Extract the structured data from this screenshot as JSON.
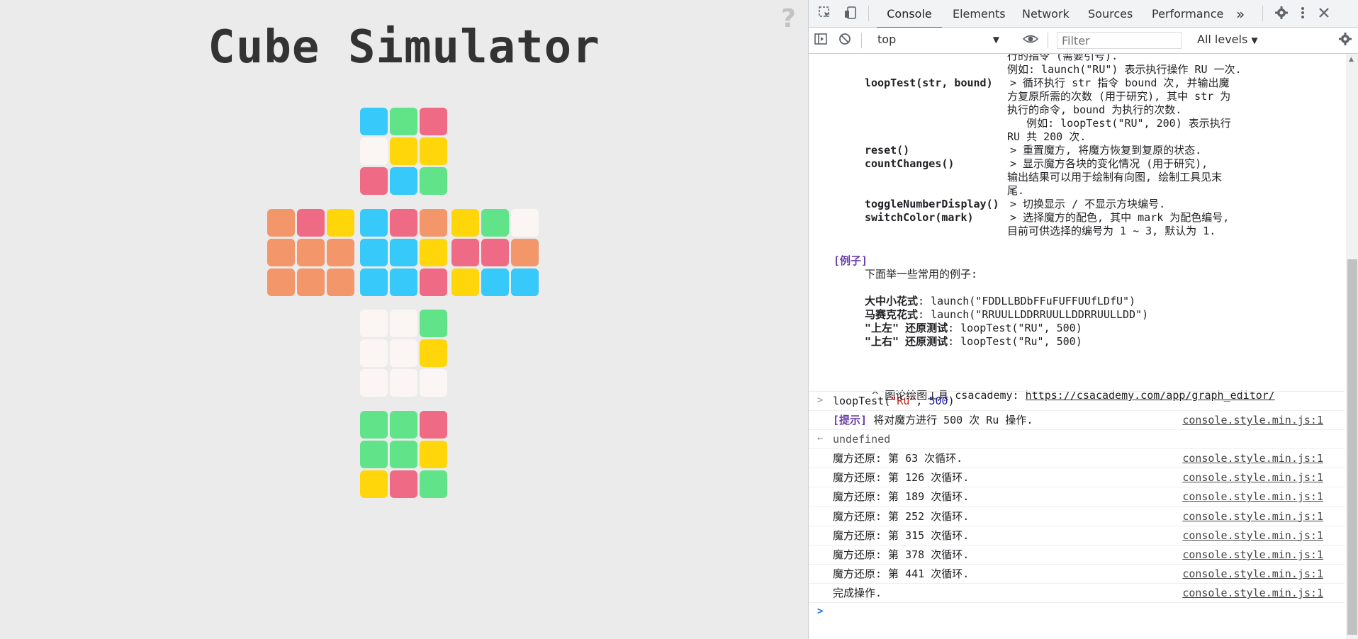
{
  "page": {
    "title": "Cube Simulator",
    "help_icon": "?"
  },
  "cube": {
    "colors": {
      "W": "#fbf6f4",
      "Y": "#ffd60a",
      "G": "#61e38a",
      "B": "#36c9f9",
      "R": "#ee6a85",
      "O": "#f3966a"
    },
    "faces": {
      "up": [
        "B",
        "G",
        "R",
        "W",
        "Y",
        "Y",
        "R",
        "B",
        "G"
      ],
      "left": [
        "O",
        "R",
        "Y",
        "O",
        "O",
        "O",
        "O",
        "O",
        "O"
      ],
      "front": [
        "B",
        "R",
        "O",
        "B",
        "B",
        "Y",
        "B",
        "B",
        "R"
      ],
      "right": [
        "Y",
        "G",
        "W",
        "R",
        "R",
        "O",
        "Y",
        "B",
        "B"
      ],
      "down": [
        "W",
        "W",
        "G",
        "W",
        "W",
        "Y",
        "W",
        "W",
        "W"
      ],
      "back": [
        "G",
        "G",
        "R",
        "G",
        "G",
        "Y",
        "Y",
        "R",
        "G"
      ]
    }
  },
  "devtools": {
    "tabs": [
      "Console",
      "Elements",
      "Network",
      "Sources",
      "Performance"
    ],
    "more_tabs": "»",
    "context": "top",
    "filter_placeholder": "Filter",
    "levels": "All levels",
    "help_lines": [
      {
        "cmd": "",
        "desc": "行的指令 (需要引号)."
      },
      {
        "cmd": "",
        "desc": "例如: launch(\"RU\") 表示执行操作 RU 一次."
      },
      {
        "cmd": "loopTest(str, bound)",
        "desc": "> 循环执行 str 指令 bound 次, 并输出魔"
      },
      {
        "cmd": "",
        "desc": "方复原所需的次数 (用于研究), 其中 str 为"
      },
      {
        "cmd": "",
        "desc": "执行的命令, bound 为执行的次数."
      },
      {
        "cmd": "",
        "desc": "   例如: loopTest(\"RU\", 200) 表示执行"
      },
      {
        "cmd": "",
        "desc": "RU 共 200 次."
      },
      {
        "cmd": "reset()",
        "desc": "> 重置魔方, 将魔方恢复到复原的状态."
      },
      {
        "cmd": "countChanges()",
        "desc": "> 显示魔方各块的变化情况 (用于研究),"
      },
      {
        "cmd": "",
        "desc": "输出结果可以用于绘制有向图, 绘制工具见末"
      },
      {
        "cmd": "",
        "desc": "尾."
      },
      {
        "cmd": "toggleNumberDisplay()",
        "desc": "> 切换显示 / 不显示方块编号."
      },
      {
        "cmd": "switchColor(mark)",
        "desc": "> 选择魔方的配色, 其中 mark 为配色编号,"
      },
      {
        "cmd": "",
        "desc": "目前可供选择的编号为 1 ~ 3, 默认为 1."
      }
    ],
    "examples_heading": "[例子]",
    "examples_intro": "下面举一些常用的例子:",
    "examples": [
      {
        "name": "大中小花式",
        "code": ": launch(\"FDDLLBDbFFuFUFFUUfLDfU\")"
      },
      {
        "name": "马赛克花式",
        "code": ": launch(\"RRUULLDDRRUULLDDRRUULLDD\")"
      },
      {
        "name": "\"上左\" 还原测试",
        "code": ": loopTest(\"RU\", 500)"
      },
      {
        "name": "\"上右\" 还原测试",
        "code": ": loopTest(\"Ru\", 500)"
      }
    ],
    "graph_tool_label": "^ 图论绘图工具 csacademy: ",
    "graph_tool_url": "https://csacademy.com/app/graph_editor/",
    "input_cmd": "loopTest(",
    "input_str": "\"Ru\"",
    "input_comma": ", ",
    "input_num": "500",
    "input_close": ")",
    "hint_tag": "[提示]",
    "hint_text": " 将对魔方进行 500 次 Ru 操作.",
    "source": "console.style.min.js:1",
    "return_value": "undefined",
    "logs": [
      "魔方还原: 第 63 次循环.",
      "魔方还原: 第 126 次循环.",
      "魔方还原: 第 189 次循环.",
      "魔方还原: 第 252 次循环.",
      "魔方还原: 第 315 次循环.",
      "魔方还原: 第 378 次循环.",
      "魔方还原: 第 441 次循环.",
      "完成操作."
    ]
  }
}
